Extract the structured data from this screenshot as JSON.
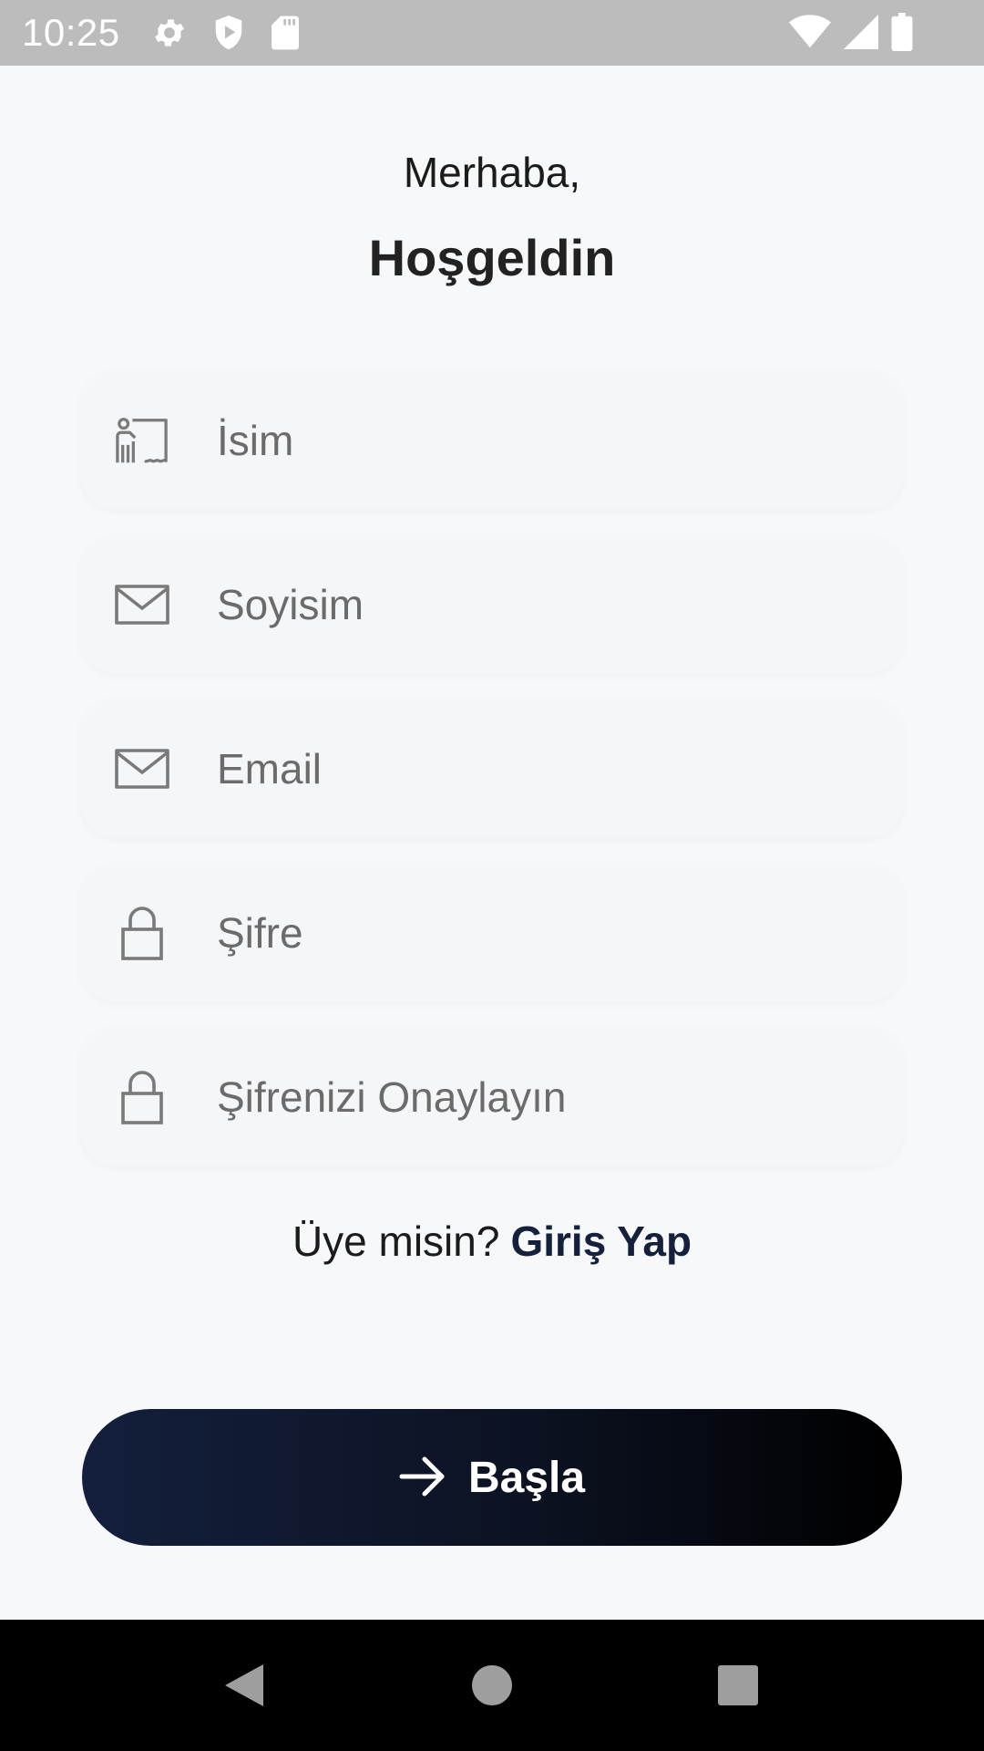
{
  "status_bar": {
    "time": "10:25",
    "left_icons": [
      "gear-icon",
      "shield-icon",
      "sd-card-icon"
    ],
    "right_icons": [
      "wifi-icon",
      "signal-icon",
      "battery-icon"
    ]
  },
  "header": {
    "greeting": "Merhaba,",
    "welcome": "Hoşgeldin"
  },
  "form": {
    "fields": [
      {
        "icon": "id-card-icon",
        "placeholder": "İsim",
        "value": ""
      },
      {
        "icon": "mail-icon",
        "placeholder": "Soyisim",
        "value": ""
      },
      {
        "icon": "mail-icon",
        "placeholder": "Email",
        "value": ""
      },
      {
        "icon": "lock-icon",
        "placeholder": "Şifre",
        "value": ""
      },
      {
        "icon": "lock-icon",
        "placeholder": "Şifrenizi Onaylayın",
        "value": ""
      }
    ]
  },
  "login_prompt": {
    "question": "Üye misin?",
    "link": "Giriş Yap"
  },
  "start_button": {
    "label": "Başla",
    "icon": "arrow-right-icon"
  },
  "nav_bar": {
    "buttons": [
      "back-icon",
      "home-icon",
      "recents-icon"
    ]
  },
  "colors": {
    "status_bar_bg": "#bcbcbc",
    "page_bg": "#f7f8fa",
    "field_bg": "#f5f6f8",
    "link_color": "#15203d",
    "button_gradient_start": "#131f3c",
    "button_gradient_end": "#000000",
    "nav_bar_bg": "#000000"
  }
}
